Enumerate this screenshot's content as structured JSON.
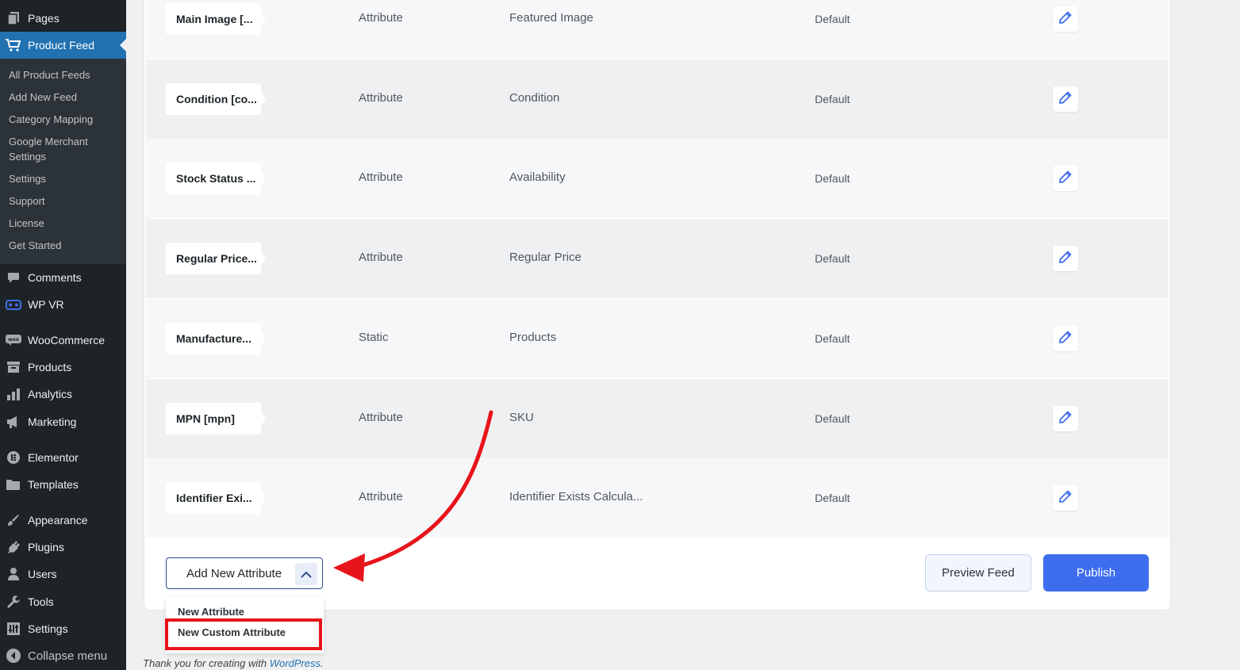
{
  "sidebar": {
    "top_items": [
      {
        "label": "Pages",
        "icon": "pages-icon"
      },
      {
        "label": "Product Feed",
        "icon": "cart-icon",
        "active": true
      }
    ],
    "submenu": [
      "All Product Feeds",
      "Add New Feed",
      "Category Mapping",
      "Google Merchant",
      "Settings",
      "Settings",
      "Support",
      "License",
      "Get Started"
    ],
    "items": [
      {
        "label": "Comments",
        "icon": "comment-icon"
      },
      {
        "label": "WP VR",
        "icon": "vr-icon"
      },
      {
        "label": "WooCommerce",
        "icon": "woo-icon"
      },
      {
        "label": "Products",
        "icon": "archive-icon"
      },
      {
        "label": "Analytics",
        "icon": "bar-chart-icon"
      },
      {
        "label": "Marketing",
        "icon": "megaphone-icon"
      },
      {
        "label": "Elementor",
        "icon": "elementor-icon"
      },
      {
        "label": "Templates",
        "icon": "folder-icon"
      },
      {
        "label": "Appearance",
        "icon": "brush-icon"
      },
      {
        "label": "Plugins",
        "icon": "plugin-icon"
      },
      {
        "label": "Users",
        "icon": "user-icon"
      },
      {
        "label": "Tools",
        "icon": "wrench-icon"
      },
      {
        "label": "Settings",
        "icon": "settings-icon"
      },
      {
        "label": "Collapse menu",
        "icon": "collapse-icon"
      }
    ]
  },
  "rows": [
    {
      "attribute": "Main Image [...",
      "type": "Attribute",
      "value": "Featured Image",
      "default": "Default"
    },
    {
      "attribute": "Condition [co...",
      "type": "Attribute",
      "value": "Condition",
      "default": "Default"
    },
    {
      "attribute": "Stock Status ...",
      "type": "Attribute",
      "value": "Availability",
      "default": "Default"
    },
    {
      "attribute": "Regular Price...",
      "type": "Attribute",
      "value": "Regular Price",
      "default": "Default"
    },
    {
      "attribute": "Manufacture...",
      "type": "Static",
      "value": "Products",
      "default": "Default"
    },
    {
      "attribute": "MPN [mpn]",
      "type": "Attribute",
      "value": "SKU",
      "default": "Default"
    },
    {
      "attribute": "Identifier Exi...",
      "type": "Attribute",
      "value": "Identifier Exists Calcula...",
      "default": "Default"
    }
  ],
  "actions": {
    "add_attribute_label": "Add New Attribute",
    "dropdown_items": [
      "New Attribute",
      "New Custom Attribute"
    ],
    "preview_label": "Preview Feed",
    "publish_label": "Publish"
  },
  "footer": {
    "text": "Thank you for creating with ",
    "link": "WordPress",
    "suffix": "."
  },
  "colors": {
    "accent": "#2271b1",
    "publish": "#3d6ded",
    "highlight": "#e8141b"
  }
}
